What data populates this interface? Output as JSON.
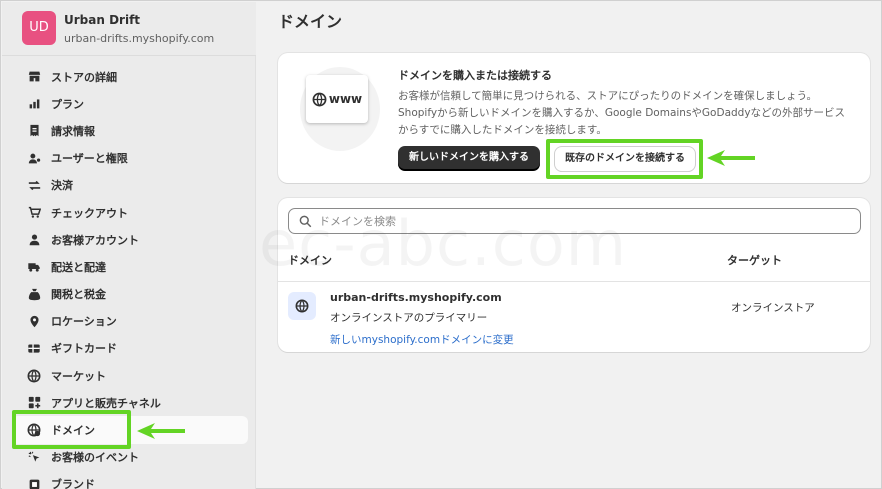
{
  "store": {
    "initials": "UD",
    "name": "Urban Drift",
    "url": "urban-drifts.myshopify.com"
  },
  "nav": {
    "items": [
      {
        "label": "ストアの詳細",
        "icon": "store-icon"
      },
      {
        "label": "プラン",
        "icon": "plan-chart-icon"
      },
      {
        "label": "請求情報",
        "icon": "billing-receipt-icon"
      },
      {
        "label": "ユーザーと権限",
        "icon": "user-permissions-icon"
      },
      {
        "label": "決済",
        "icon": "payments-icon"
      },
      {
        "label": "チェックアウト",
        "icon": "cart-icon"
      },
      {
        "label": "お客様アカウント",
        "icon": "person-icon"
      },
      {
        "label": "配送と配達",
        "icon": "truck-icon"
      },
      {
        "label": "関税と税金",
        "icon": "tax-bag-icon"
      },
      {
        "label": "ロケーション",
        "icon": "location-pin-icon"
      },
      {
        "label": "ギフトカード",
        "icon": "gift-card-icon"
      },
      {
        "label": "マーケット",
        "icon": "globe-market-icon"
      },
      {
        "label": "アプリと販売チャネル",
        "icon": "apps-icon"
      },
      {
        "label": "ドメイン",
        "icon": "globe-domain-icon"
      },
      {
        "label": "お客様のイベント",
        "icon": "cursor-events-icon"
      },
      {
        "label": "ブランド",
        "icon": "brand-icon"
      }
    ],
    "active_index": 13
  },
  "page": {
    "title": "ドメイン"
  },
  "buy_card": {
    "illustration_text": "www",
    "title": "ドメインを購入または接続する",
    "description": "お客様が信頼して簡単に見つけられる、ストアにぴったりのドメインを確保しましょう。Shopifyから新しいドメインを購入するか、Google DomainsやGoDaddyなどの外部サービスからすでに購入したドメインを接続します。",
    "buy_button": "新しいドメインを購入する",
    "connect_button": "既存のドメインを接続する"
  },
  "domains": {
    "search_placeholder": "ドメインを検索",
    "col_domain": "ドメイン",
    "col_target": "ターゲット",
    "rows": [
      {
        "name": "urban-drifts.myshopify.com",
        "sub": "オンラインストアのプライマリー",
        "link": "新しいmyshopify.comドメインに変更",
        "target": "オンラインストア"
      }
    ]
  },
  "watermark": "ec-abc.com",
  "colors": {
    "highlight": "#63d424",
    "avatar": "#e85181",
    "link": "#2c6ecb",
    "primary_button": "#303030"
  }
}
